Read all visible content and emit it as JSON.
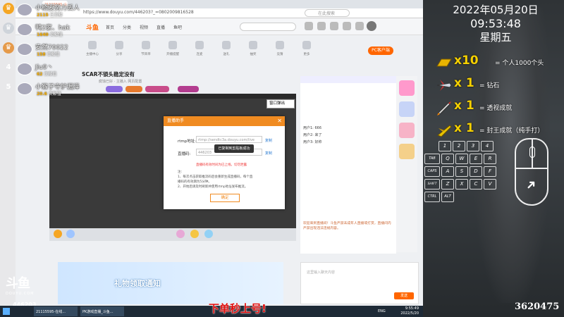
{
  "browser": {
    "tab_title": "21115595-斗鱼",
    "url": "https://www.douyu.com/446203?_=0802009816528",
    "search_placeholder": "在此搜索",
    "room_title": "SCAR不锁头稳定没有",
    "room_subtitle": "腐蚀已好 · 主播入 网页配置",
    "record_button": "PC客户端",
    "nav_items": [
      "首页",
      "分类",
      "视频",
      "直播",
      "鱼吧"
    ],
    "toolbar_items": [
      "主播中心",
      "分享",
      "节目单",
      "开播提醒",
      "连麦",
      "送礼",
      "抽奖",
      "竞猜",
      "更多"
    ],
    "popout_label": "窗口弹出",
    "chat_lines": [
      "用户1: 666",
      "用户2: 来了",
      "用户3: 好帅"
    ],
    "chat_notice": "欢迎来到直播间！斗鱼严禁未成年人直播或打赏，直播间内严禁出现违法违规内容。",
    "chat_input_hint": "这里输入聊天内容",
    "send_label": "发送",
    "banner_text": "礼物领取通知"
  },
  "dialog": {
    "title": "直播助手",
    "rtmp_label": "rtmp地址:",
    "rtmp_value": "rtmp://sendtc3a.douyu.com/live",
    "code_label": "直播码:",
    "code_value": "446203",
    "copy_label": "复制",
    "tooltip": "已复制到剪贴板成功",
    "warning": "直播码有效时间为已上线，切勿泄露",
    "notes": [
      "注:",
      "1、每次点击获取推流码后会重新生成直播码，每个直",
      "播码的有效期为5分钟。",
      "2、开始后请及时刷新并使用rtmp地址发布推流。"
    ],
    "ok_label": "确定"
  },
  "donors": [
    {
      "rank": "",
      "name": "小稽要努力丢人",
      "amount_label": "已贡献",
      "amount": "2115"
    },
    {
      "rank": "",
      "name": "鸭2家、hak",
      "amount_label": "贡献值",
      "amount": "1640"
    },
    {
      "rank": "",
      "name": "安然70022",
      "amount_label": "贡献值",
      "amount": "158"
    },
    {
      "rank": "4",
      "name": "Jiu9丶",
      "amount_label": "贡献值",
      "amount": "62"
    },
    {
      "rank": "5",
      "name": "小猴子守护漏泽",
      "amount_label": "贡献值",
      "amount": "20.6"
    }
  ],
  "brand": {
    "logo": "斗鱼",
    "logo_sub": "DOUYU.COM",
    "room_id": "446203"
  },
  "clock": {
    "date": "2022年05月20日",
    "time": "09:53:48",
    "weekday": "星期五"
  },
  "rewards": [
    {
      "icon": "gold-bar-icon",
      "qty": "x10",
      "text": "= 个人1000个头"
    },
    {
      "icon": "plane-icon",
      "qty": "x 1",
      "text": "= 钻石"
    },
    {
      "icon": "rocket-icon",
      "qty": "x 1",
      "text": "= 透视成就"
    },
    {
      "icon": "jet-icon",
      "qty": "x 1",
      "text": "= 封王成就（纯手打）"
    }
  ],
  "keys": [
    {
      "label": "1"
    },
    {
      "label": "2"
    },
    {
      "label": "3"
    },
    {
      "label": "4"
    },
    {
      "label": "TAB"
    },
    {
      "label": "Q"
    },
    {
      "label": "W"
    },
    {
      "label": "E"
    },
    {
      "label": "R"
    },
    {
      "label": "CAPS"
    },
    {
      "label": "A"
    },
    {
      "label": "S"
    },
    {
      "label": "D"
    },
    {
      "label": "F"
    },
    {
      "label": "SHIFT"
    },
    {
      "label": "Z"
    },
    {
      "label": "X"
    },
    {
      "label": "C"
    },
    {
      "label": "V"
    },
    {
      "label": "CTRL"
    },
    {
      "label": "ALT"
    }
  ],
  "stream_id": "3620475",
  "subtitle": "下单秒上号!",
  "taskbar": {
    "tasks": [
      "21115595-在线...",
      "PK游戏直播_斗鱼..."
    ],
    "lang": "ENG",
    "time": "9:55:49",
    "date": "2022/5/20"
  },
  "colors": {
    "accent": "#f08b21",
    "gold": "#f5d000",
    "red": "#e01010"
  }
}
